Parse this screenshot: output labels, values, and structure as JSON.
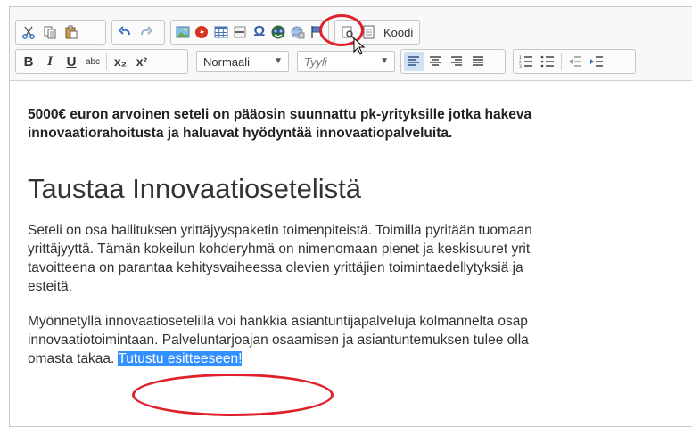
{
  "toolbar": {
    "format_combo": "Normaali",
    "style_combo": "Tyyli",
    "koodi_label": "Koodi",
    "bold_label": "B",
    "italic_label": "I",
    "underline_label": "U",
    "strike_label": "abc",
    "subscript_label": "x₂",
    "superscript_label": "x²"
  },
  "content": {
    "lead_line1": "5000€ euron arvoinen seteli on pääosin suunnattu pk-yrityksille jotka hakeva",
    "lead_line2": "innovaatiorahoitusta ja haluavat hyödyntää innovaatiopalveluita.",
    "heading": "Taustaa Innovaatiosetelistä",
    "p1_line1": "Seteli on osa hallituksen yrittäjyyspaketin toimenpiteistä. Toimilla pyritään tuomaan",
    "p1_line2": "yrittäjyyttä. Tämän kokeilun kohderyhmä on nimenomaan pienet ja keskisuuret yrit",
    "p1_line3": "tavoitteena on parantaa kehitysvaiheessa olevien yrittäjien toimintaedellytyksiä ja",
    "p1_line4": "esteitä.",
    "p2_line1": "Myönnetyllä innovaatiosetelillä voi hankkia asiantuntijapalveluja kolmannelta osap",
    "p2_line2": "innovaatiotoimintaan. Palveluntarjoajan osaamisen ja asiantuntemuksen tulee olla",
    "p2_line3_prefix": "omasta takaa. ",
    "p2_link": "Tutustu esitteeseen!"
  },
  "colors": {
    "annotation": "#e0202a",
    "selection": "#3390ff"
  }
}
